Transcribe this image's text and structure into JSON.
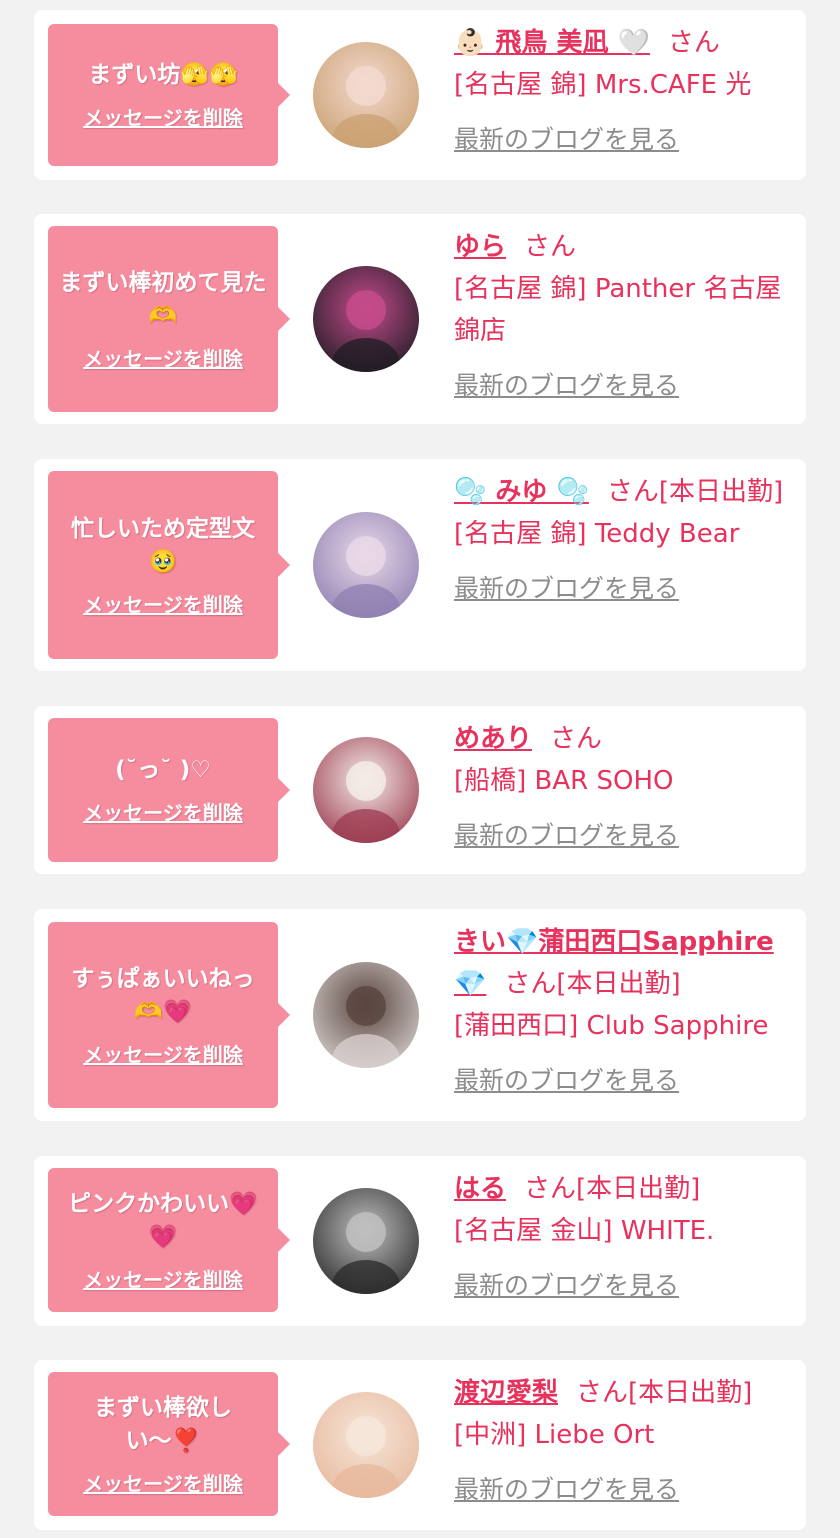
{
  "messages": [
    {
      "message": "まずい坊🫣🫣",
      "delete_label": "メッセージを削除",
      "name": "👶🏻 飛鳥 美凪 🤍",
      "san": "さん",
      "shop": "[名古屋 錦] Mrs.CAFE 光",
      "blog_label": "最新のブログを見る",
      "avatar_colors": [
        "#c9a070",
        "#f3d9cf"
      ]
    },
    {
      "message": "まずい棒初めて見た🫶",
      "delete_label": "メッセージを削除",
      "name": "ゆら",
      "san": "さん",
      "shop": "[名古屋 錦] Panther 名古屋錦店",
      "blog_label": "最新のブログを見る",
      "avatar_colors": [
        "#1c1c22",
        "#c64b8c"
      ]
    },
    {
      "message": "忙しいため定型文🥹",
      "delete_label": "メッセージを削除",
      "name": "🫧 みゆ 🫧",
      "san": "さん[本日出勤]",
      "shop": "[名古屋 錦] Teddy Bear",
      "blog_label": "最新のブログを見る",
      "avatar_colors": [
        "#8e7fb1",
        "#e9d8e8"
      ]
    },
    {
      "message": "(˘っ˘ )♡",
      "delete_label": "メッセージを削除",
      "name": "めあり",
      "san": "さん",
      "shop": "[船橋] BAR SOHO",
      "blog_label": "最新のブログを見る",
      "avatar_colors": [
        "#9b3a4f",
        "#f4ece8"
      ]
    },
    {
      "message": "すぅぱぁいいねっ🫶💗",
      "delete_label": "メッセージを削除",
      "name": "きい💎蒲田西口Sapphire💎",
      "san": "さん[本日出勤]",
      "shop": "[蒲田西口] Club Sapphire",
      "blog_label": "最新のブログを見る",
      "avatar_colors": [
        "#d9d2cf",
        "#5a4640"
      ]
    },
    {
      "message": "ピンクかわいい💗💗",
      "delete_label": "メッセージを削除",
      "name": "はる",
      "san": "さん[本日出勤]",
      "shop": "[名古屋 金山] WHITE.",
      "blog_label": "最新のブログを見る",
      "avatar_colors": [
        "#2a2a2a",
        "#bfbfbf"
      ]
    },
    {
      "message": "まずい棒欲しい〜❣️",
      "delete_label": "メッセージを削除",
      "name": "渡辺愛梨",
      "san": "さん[本日出勤]",
      "shop": "[中洲] Liebe Ort",
      "blog_label": "最新のブログを見る",
      "avatar_colors": [
        "#e7b89b",
        "#f6e6da"
      ]
    }
  ]
}
